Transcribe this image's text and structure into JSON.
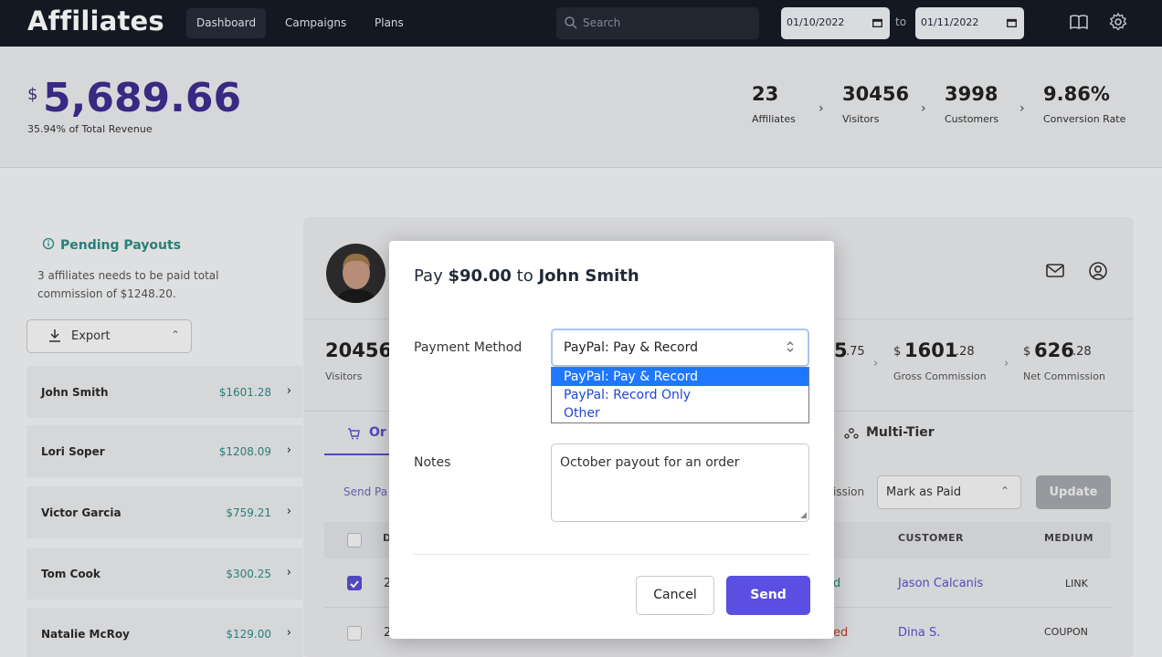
{
  "topnav": {
    "brand": "Affiliates",
    "tabs": [
      {
        "label": "Dashboard",
        "active": true
      },
      {
        "label": "Campaigns",
        "active": false
      },
      {
        "label": "Plans",
        "active": false
      }
    ],
    "search_placeholder": "Search",
    "date_from": "01/10/2022",
    "date_to": "01/11/2022",
    "to_label": "to",
    "icons": [
      "book-icon",
      "gear-icon"
    ]
  },
  "stats": {
    "currency": "$",
    "total": "5,689.66",
    "subtitle": "35.94% of Total Revenue",
    "items": [
      {
        "value": "23",
        "label": "Affiliates"
      },
      {
        "value": "30456",
        "label": "Visitors"
      },
      {
        "value": "3998",
        "label": "Customers"
      },
      {
        "value": "9.86%",
        "label": "Conversion Rate"
      }
    ]
  },
  "pending": {
    "title": "Pending Payouts",
    "text": "3 affiliates needs to be paid total commission of $1248.20."
  },
  "export_label": "Export",
  "affiliates": [
    {
      "name": "John Smith",
      "amount": "$1601.28"
    },
    {
      "name": "Lori Soper",
      "amount": "$1208.09"
    },
    {
      "name": "Victor Garcia",
      "amount": "$759.21"
    },
    {
      "name": "Tom Cook",
      "amount": "$300.25"
    },
    {
      "name": "Natalie McRoy",
      "amount": "$129.00"
    }
  ],
  "panel": {
    "visitors_value": "20456",
    "visitors_label": "Visitors",
    "partial_value": "5",
    "partial_cents": ".75",
    "gross_currency": "$",
    "gross_value": "1601",
    "gross_cents": ".28",
    "gross_label": "Gross Commission",
    "net_currency": "$",
    "net_value": "626",
    "net_cents": ".28",
    "net_label": "Net Commission",
    "tab_partial": "Or",
    "tab_multitier": "Multi-Tier",
    "send_partial": "Send Pa",
    "ission_partial": "ission",
    "mark_paid": "Mark as Paid",
    "update": "Update",
    "col_d": "D",
    "col_customer": "CUSTOMER",
    "col_medium": "MEDIUM",
    "rows": [
      {
        "prefix": "2",
        "status_partial": "d",
        "customer": "Jason Calcanis",
        "medium": "LINK",
        "checked": true
      },
      {
        "prefix": "2",
        "status_partial": "ed",
        "customer": "Dina S.",
        "medium": "COUPON",
        "checked": false
      }
    ]
  },
  "modal": {
    "title_prefix": "Pay ",
    "amount": "$90.00",
    "title_mid": " to ",
    "name": "John Smith",
    "payment_label": "Payment Method",
    "payment_selected": "PayPal: Pay & Record",
    "options": [
      "PayPal: Pay & Record",
      "PayPal: Record Only",
      "Other"
    ],
    "notes_label": "Notes",
    "notes_value": "October payout for an order",
    "cancel": "Cancel",
    "send": "Send"
  }
}
